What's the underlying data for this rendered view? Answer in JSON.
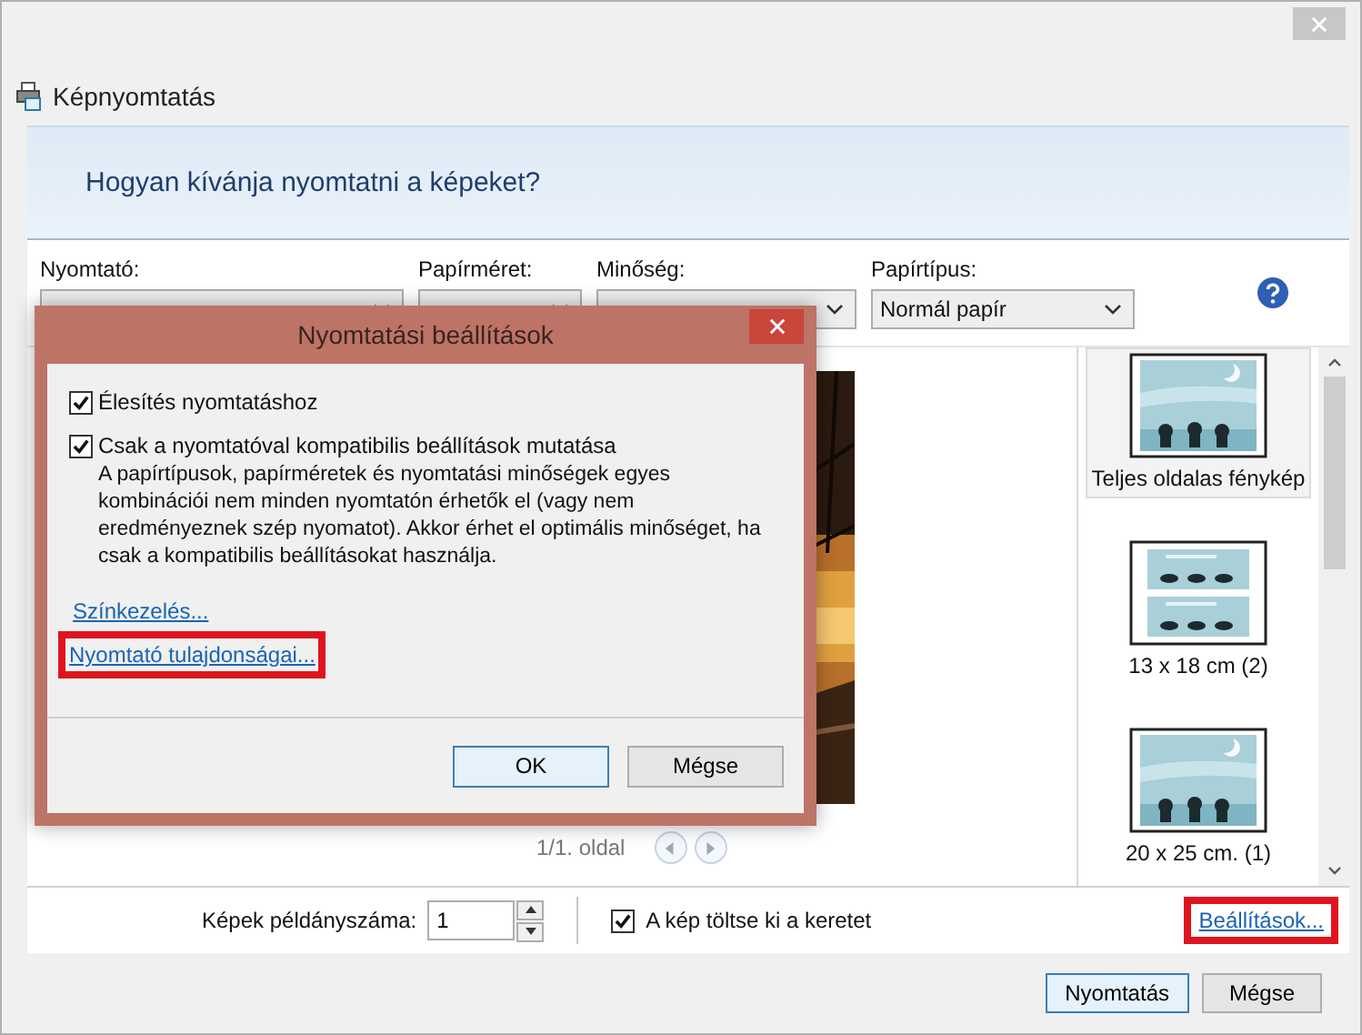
{
  "window": {
    "title": "Képnyomtatás"
  },
  "header": "Hogyan kívánja nyomtatni a képeket?",
  "options": [
    {
      "label": "Nyomtató:"
    },
    {
      "label": "Papírméret:"
    },
    {
      "label": "Minőség:"
    },
    {
      "label": "Papírtípus:",
      "value": "Normál papír"
    }
  ],
  "preview": {
    "page": "1/1. oldal"
  },
  "layouts": [
    {
      "label": "Teljes oldalas fénykép",
      "selected": true,
      "kind": "single"
    },
    {
      "label": "13 x 18 cm (2)",
      "selected": false,
      "kind": "double"
    },
    {
      "label": "20 x 25 cm. (1)",
      "selected": false,
      "kind": "single"
    }
  ],
  "copies": {
    "label": "Képek példányszáma:",
    "value": "1"
  },
  "fill_frame": {
    "label": "A kép töltse ki a keretet",
    "checked": true
  },
  "settings_link": {
    "label": "Beállítások...",
    "highlighted": true
  },
  "buttons": [
    {
      "label": "Nyomtatás",
      "default": true
    },
    {
      "label": "Mégse",
      "default": false
    }
  ],
  "dialog": {
    "title": "Nyomtatási beállítások",
    "options": [
      {
        "label": "Élesítés nyomtatáshoz",
        "checked": true
      },
      {
        "label": "Csak a nyomtatóval kompatibilis beállítások mutatása",
        "checked": true,
        "description": "A papírtípusok, papírméretek és nyomtatási minőségek egyes kombinációi nem minden nyomtatón érhetők el (vagy nem eredményeznek szép nyomatot). Akkor érhet el optimális minőséget, ha csak a kompatibilis beállításokat használja."
      }
    ],
    "links": [
      {
        "label": "Színkezelés...",
        "highlighted": false
      },
      {
        "label": "Nyomtató tulajdonságai...",
        "highlighted": true
      }
    ],
    "buttons": [
      {
        "label": "OK",
        "default": true
      },
      {
        "label": "Mégse",
        "default": false
      }
    ]
  }
}
